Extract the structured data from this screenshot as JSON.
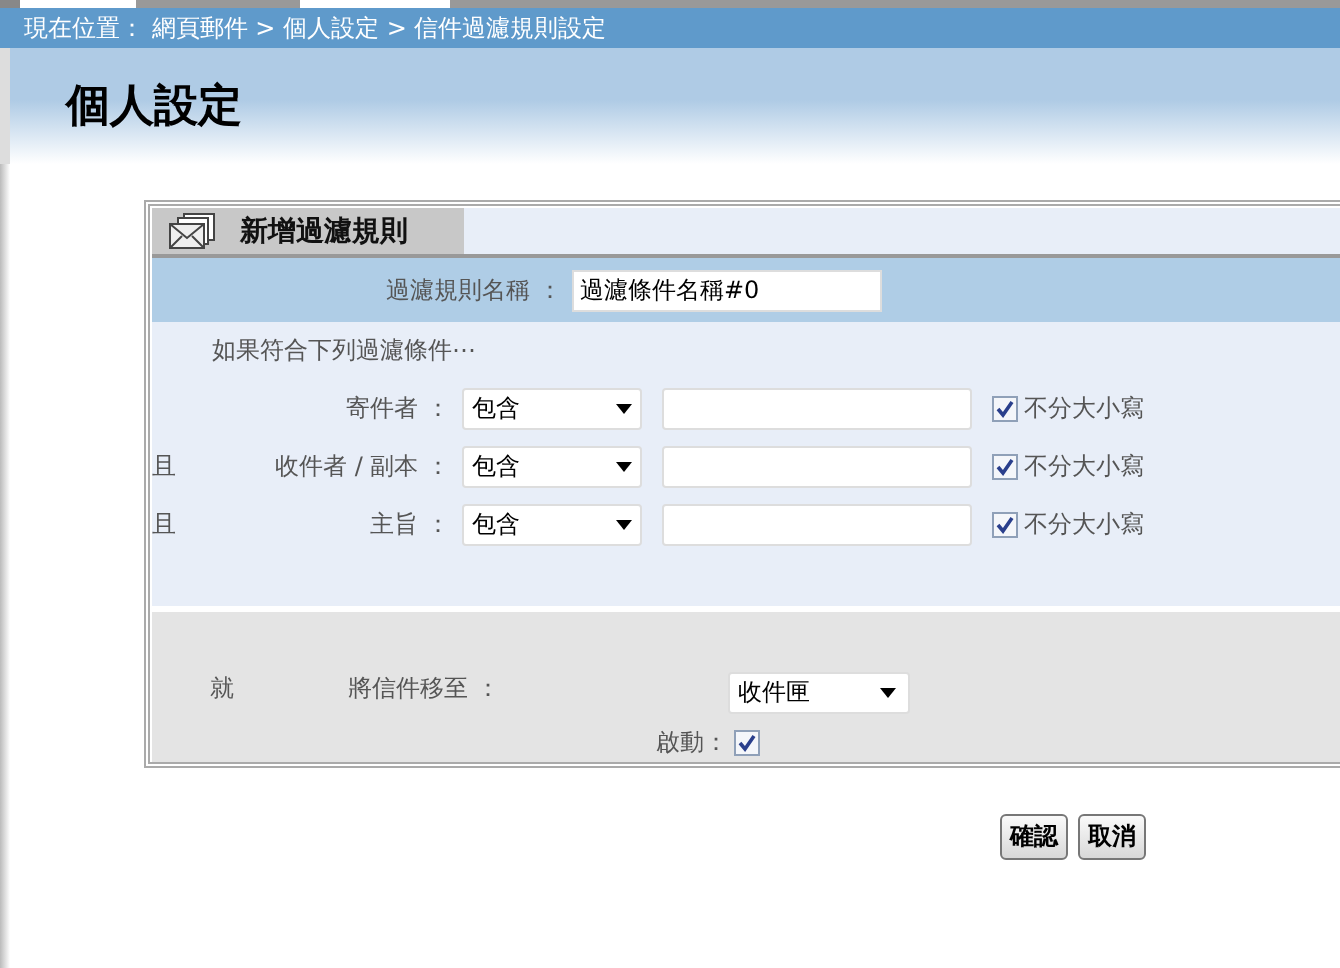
{
  "breadcrumb": "現在位置： 網頁郵件 > 個人設定 > 信件過濾規則設定",
  "page_title": "個人設定",
  "panel": {
    "title": "新增過濾規則",
    "rule_name": {
      "label": "過濾規則名稱 ：",
      "value": "過濾條件名稱#0"
    },
    "intro": "如果符合下列過濾條件⋯",
    "conditions": [
      {
        "label": "寄件者 ：",
        "operator": "包含",
        "case_label": "不分大小寫",
        "case_insensitive": true
      },
      {
        "conjunction": "且",
        "label": "收件者 / 副本 ：",
        "operator": "包含",
        "case_label": "不分大小寫",
        "case_insensitive": true
      },
      {
        "conjunction": "且",
        "label": "主旨 ：",
        "operator": "包含",
        "case_label": "不分大小寫",
        "case_insensitive": true
      }
    ],
    "action": {
      "then": "就",
      "label": "將信件移至 ：",
      "folder": "收件匣",
      "enable_label": "啟動：",
      "enabled": true
    }
  },
  "buttons": [
    "確認",
    "取消"
  ]
}
